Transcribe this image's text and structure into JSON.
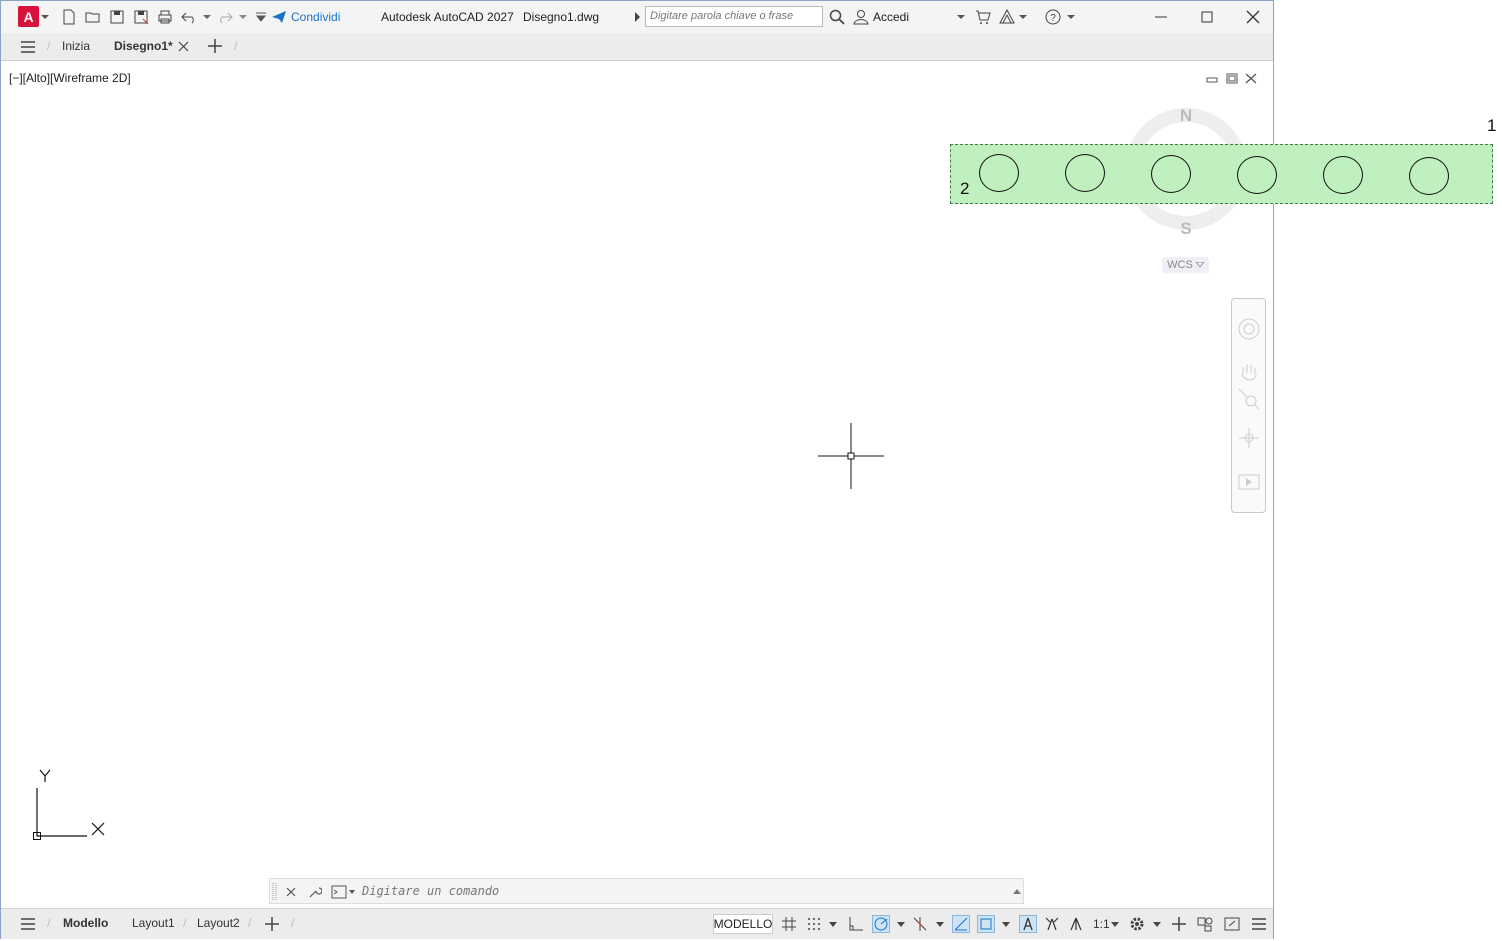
{
  "titlebar": {
    "app_logo": "A",
    "share_label": "Condividi",
    "title": "Autodesk AutoCAD 2027",
    "filename": "Disegno1.dwg",
    "search_placeholder": "Digitare parola chiave o frase",
    "signin_label": "Accedi"
  },
  "tabs": {
    "home": "Inizia",
    "drawing": "Disegno1*"
  },
  "viewport": {
    "label": "[−][Alto][Wireframe 2D]",
    "compass_north": "N",
    "compass_south": "S",
    "wcs_label": "WCS",
    "ucs_x": "X",
    "ucs_y": "Y"
  },
  "annotations": {
    "label_1": "1",
    "label_2": "2",
    "circle_count": 6
  },
  "command_line": {
    "placeholder": "Digitare un comando"
  },
  "statusbar": {
    "model_tab": "Modello",
    "layout1": "Layout1",
    "layout2": "Layout2",
    "model_button": "MODELLO",
    "scale": "1:1"
  },
  "colors": {
    "accent": "#1a73c9",
    "logo": "#d8123c",
    "selection_fill": "#c0f0c0"
  }
}
